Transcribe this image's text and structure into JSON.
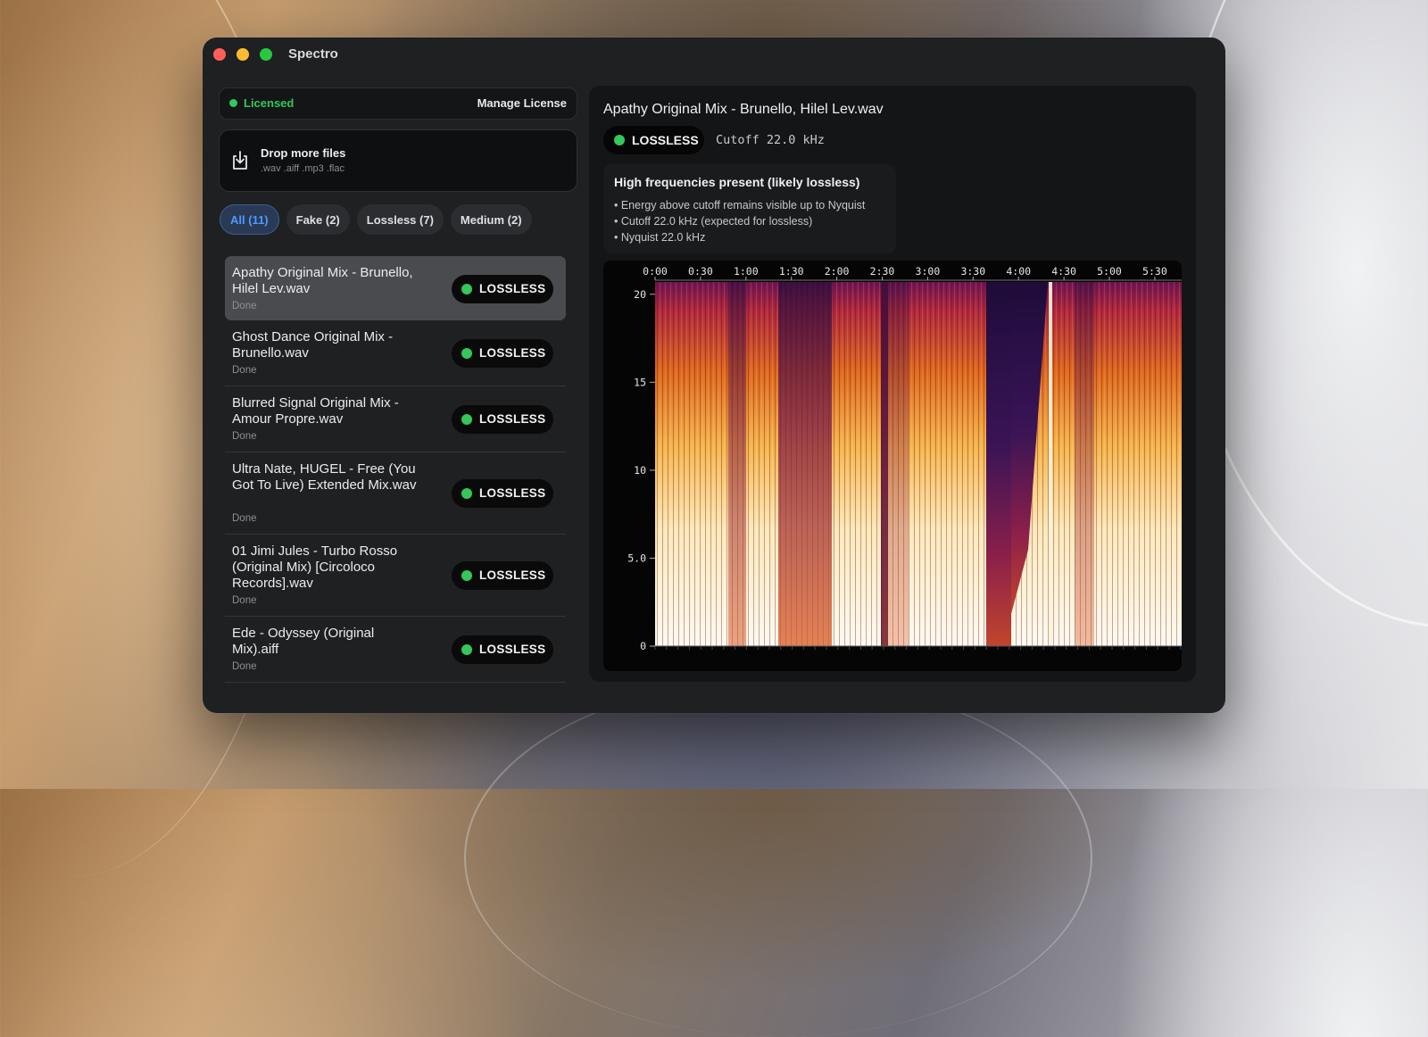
{
  "window": {
    "title": "Spectro"
  },
  "license": {
    "status": "Licensed",
    "manage_label": "Manage License"
  },
  "drop_zone": {
    "title": "Drop more files",
    "formats": ".wav .aiff .mp3 .flac"
  },
  "filters": [
    {
      "label": "All (11)",
      "active": true
    },
    {
      "label": "Fake (2)",
      "active": false
    },
    {
      "label": "Lossless (7)",
      "active": false
    },
    {
      "label": "Medium (2)",
      "active": false
    }
  ],
  "files": [
    {
      "name": "Apathy Original Mix - Brunello, Hilel Lev.wav",
      "status": "Done",
      "badge": "LOSSLESS",
      "selected": true
    },
    {
      "name": "Ghost Dance Original Mix - Brunello.wav",
      "status": "Done",
      "badge": "LOSSLESS",
      "selected": false
    },
    {
      "name": "Blurred Signal Original Mix - Amour Propre.wav",
      "status": "Done",
      "badge": "LOSSLESS",
      "selected": false
    },
    {
      "name": "Ultra Nate, HUGEL - Free (You Got To Live) Extended Mix.wav",
      "status": "Done",
      "badge": "LOSSLESS",
      "selected": false
    },
    {
      "name": "01 Jimi Jules - Turbo Rosso (Original Mix) [Circoloco Records].wav",
      "status": "Done",
      "badge": "LOSSLESS",
      "selected": false
    },
    {
      "name": "Ede - Odyssey (Original Mix).aiff",
      "status": "Done",
      "badge": "LOSSLESS",
      "selected": false
    }
  ],
  "detail": {
    "title": "Apathy Original Mix - Brunello, Hilel Lev.wav",
    "badge": "LOSSLESS",
    "cutoff": "Cutoff 22.0 kHz",
    "analysis_title": "High frequencies present (likely lossless)",
    "analysis_points": [
      "• Energy above cutoff remains visible up to Nyquist",
      "• Cutoff 22.0 kHz (expected for lossless)",
      "• Nyquist 22.0 kHz"
    ]
  },
  "spectrogram": {
    "x_ticks": [
      "0:00",
      "0:30",
      "1:00",
      "1:30",
      "2:00",
      "2:30",
      "3:00",
      "3:30",
      "4:00",
      "4:30",
      "5:00",
      "5:30",
      "5:"
    ],
    "y_ticks": [
      {
        "label": "20",
        "khz": 20
      },
      {
        "label": "15",
        "khz": 15
      },
      {
        "label": "10",
        "khz": 10
      },
      {
        "label": "5.0",
        "khz": 5
      },
      {
        "label": "0",
        "khz": 0
      }
    ]
  },
  "colors": {
    "accent_green": "#34c759",
    "active_chip": "#4d9bff"
  }
}
